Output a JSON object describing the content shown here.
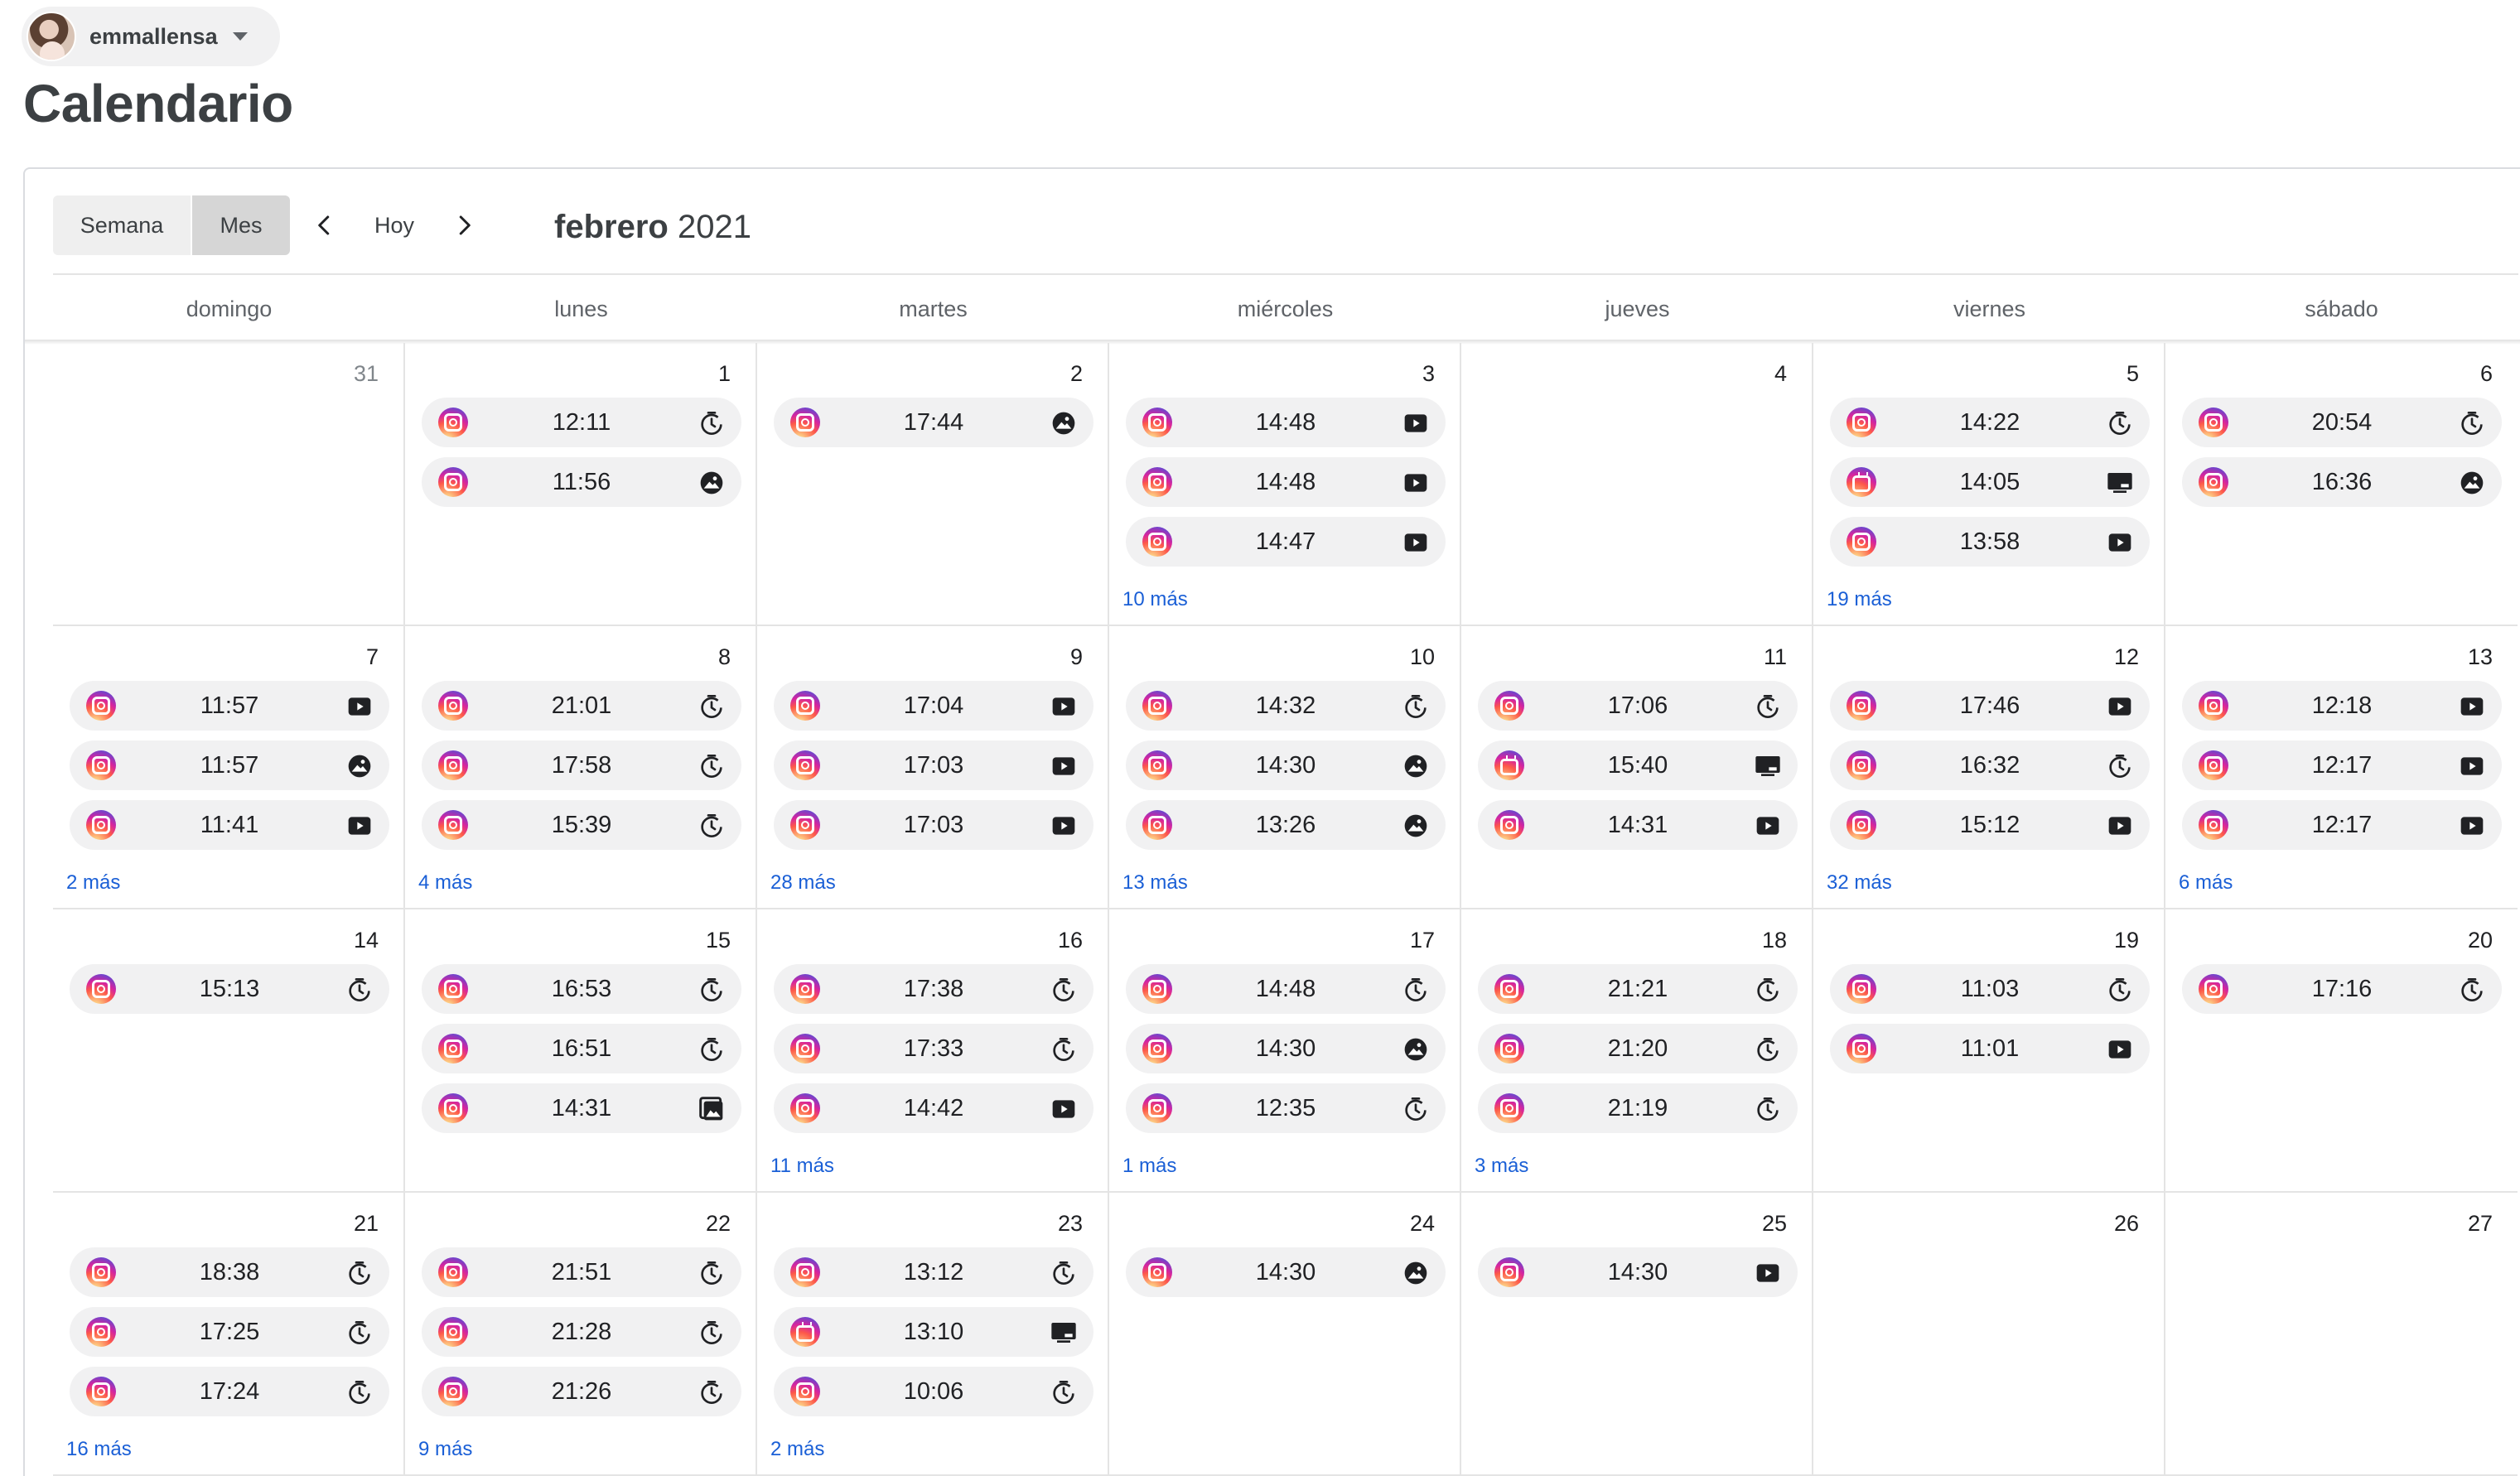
{
  "account": {
    "name": "emmallensa"
  },
  "page": {
    "title": "Calendario"
  },
  "toolbar": {
    "week_label": "Semana",
    "month_label": "Mes",
    "today_label": "Hoy",
    "month": "febrero",
    "year": "2021"
  },
  "weekdays": [
    "domingo",
    "lunes",
    "martes",
    "miércoles",
    "jueves",
    "viernes",
    "sábado"
  ],
  "weeks": [
    [
      {
        "day": "31",
        "muted": true,
        "events": [],
        "more": ""
      },
      {
        "day": "1",
        "events": [
          {
            "time": "12:11",
            "type": "clock"
          },
          {
            "time": "11:56",
            "type": "photo"
          }
        ],
        "more": ""
      },
      {
        "day": "2",
        "events": [
          {
            "time": "17:44",
            "type": "photo"
          }
        ],
        "more": ""
      },
      {
        "day": "3",
        "events": [
          {
            "time": "14:48",
            "type": "video"
          },
          {
            "time": "14:48",
            "type": "video"
          },
          {
            "time": "14:47",
            "type": "video"
          }
        ],
        "more": "10 más"
      },
      {
        "day": "4",
        "events": [],
        "more": ""
      },
      {
        "day": "5",
        "events": [
          {
            "time": "14:22",
            "type": "clock"
          },
          {
            "time": "14:05",
            "type": "tv",
            "igtv": true
          },
          {
            "time": "13:58",
            "type": "video"
          }
        ],
        "more": "19 más"
      },
      {
        "day": "6",
        "events": [
          {
            "time": "20:54",
            "type": "clock"
          },
          {
            "time": "16:36",
            "type": "photo"
          }
        ],
        "more": ""
      }
    ],
    [
      {
        "day": "7",
        "events": [
          {
            "time": "11:57",
            "type": "video"
          },
          {
            "time": "11:57",
            "type": "photo"
          },
          {
            "time": "11:41",
            "type": "video"
          }
        ],
        "more": "2 más"
      },
      {
        "day": "8",
        "events": [
          {
            "time": "21:01",
            "type": "clock"
          },
          {
            "time": "17:58",
            "type": "clock"
          },
          {
            "time": "15:39",
            "type": "clock"
          }
        ],
        "more": "4 más"
      },
      {
        "day": "9",
        "events": [
          {
            "time": "17:04",
            "type": "video"
          },
          {
            "time": "17:03",
            "type": "video"
          },
          {
            "time": "17:03",
            "type": "video"
          }
        ],
        "more": "28 más"
      },
      {
        "day": "10",
        "events": [
          {
            "time": "14:32",
            "type": "clock"
          },
          {
            "time": "14:30",
            "type": "photo"
          },
          {
            "time": "13:26",
            "type": "photo"
          }
        ],
        "more": "13 más"
      },
      {
        "day": "11",
        "events": [
          {
            "time": "17:06",
            "type": "clock"
          },
          {
            "time": "15:40",
            "type": "tv",
            "igtv": true
          },
          {
            "time": "14:31",
            "type": "video"
          }
        ],
        "more": ""
      },
      {
        "day": "12",
        "events": [
          {
            "time": "17:46",
            "type": "video"
          },
          {
            "time": "16:32",
            "type": "clock"
          },
          {
            "time": "15:12",
            "type": "video"
          }
        ],
        "more": "32 más"
      },
      {
        "day": "13",
        "events": [
          {
            "time": "12:18",
            "type": "video"
          },
          {
            "time": "12:17",
            "type": "video"
          },
          {
            "time": "12:17",
            "type": "video"
          }
        ],
        "more": "6 más"
      }
    ],
    [
      {
        "day": "14",
        "events": [
          {
            "time": "15:13",
            "type": "clock"
          }
        ],
        "more": ""
      },
      {
        "day": "15",
        "events": [
          {
            "time": "16:53",
            "type": "clock"
          },
          {
            "time": "16:51",
            "type": "clock"
          },
          {
            "time": "14:31",
            "type": "gallery"
          }
        ],
        "more": ""
      },
      {
        "day": "16",
        "events": [
          {
            "time": "17:38",
            "type": "clock"
          },
          {
            "time": "17:33",
            "type": "clock"
          },
          {
            "time": "14:42",
            "type": "video"
          }
        ],
        "more": "11 más"
      },
      {
        "day": "17",
        "events": [
          {
            "time": "14:48",
            "type": "clock"
          },
          {
            "time": "14:30",
            "type": "photo"
          },
          {
            "time": "12:35",
            "type": "clock"
          }
        ],
        "more": "1 más"
      },
      {
        "day": "18",
        "events": [
          {
            "time": "21:21",
            "type": "clock"
          },
          {
            "time": "21:20",
            "type": "clock"
          },
          {
            "time": "21:19",
            "type": "clock"
          }
        ],
        "more": "3 más"
      },
      {
        "day": "19",
        "events": [
          {
            "time": "11:03",
            "type": "clock"
          },
          {
            "time": "11:01",
            "type": "video"
          }
        ],
        "more": ""
      },
      {
        "day": "20",
        "events": [
          {
            "time": "17:16",
            "type": "clock"
          }
        ],
        "more": ""
      }
    ],
    [
      {
        "day": "21",
        "events": [
          {
            "time": "18:38",
            "type": "clock"
          },
          {
            "time": "17:25",
            "type": "clock"
          },
          {
            "time": "17:24",
            "type": "clock"
          }
        ],
        "more": "16 más"
      },
      {
        "day": "22",
        "events": [
          {
            "time": "21:51",
            "type": "clock"
          },
          {
            "time": "21:28",
            "type": "clock"
          },
          {
            "time": "21:26",
            "type": "clock"
          }
        ],
        "more": "9 más"
      },
      {
        "day": "23",
        "events": [
          {
            "time": "13:12",
            "type": "clock"
          },
          {
            "time": "13:10",
            "type": "tv",
            "igtv": true
          },
          {
            "time": "10:06",
            "type": "clock"
          }
        ],
        "more": "2 más"
      },
      {
        "day": "24",
        "events": [
          {
            "time": "14:30",
            "type": "photo"
          }
        ],
        "more": ""
      },
      {
        "day": "25",
        "events": [
          {
            "time": "14:30",
            "type": "video"
          }
        ],
        "more": ""
      },
      {
        "day": "26",
        "events": [],
        "more": ""
      },
      {
        "day": "27",
        "events": [],
        "more": ""
      }
    ]
  ]
}
